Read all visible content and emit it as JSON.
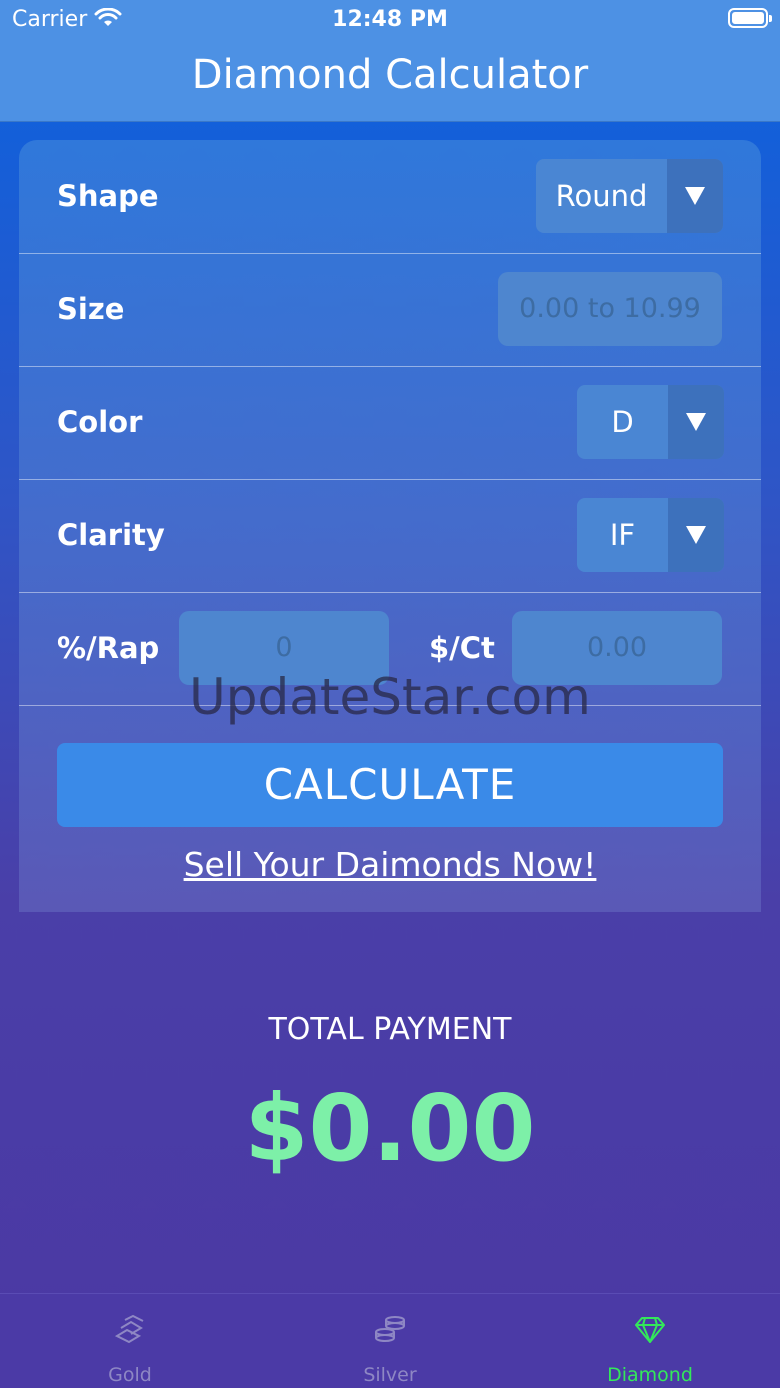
{
  "status_bar": {
    "carrier": "Carrier",
    "time": "12:48 PM"
  },
  "nav": {
    "title": "Diamond Calculator"
  },
  "form": {
    "shape": {
      "label": "Shape",
      "value": "Round"
    },
    "size": {
      "label": "Size",
      "placeholder": "0.00 to 10.99"
    },
    "color": {
      "label": "Color",
      "value": "D"
    },
    "clarity": {
      "label": "Clarity",
      "value": "IF"
    },
    "rap": {
      "label": "%/Rap",
      "placeholder": "0"
    },
    "per_ct": {
      "label": "$/Ct",
      "placeholder": "0.00"
    }
  },
  "calculate_label": "CALCULATE",
  "sell_link": "Sell Your Daimonds Now!",
  "watermark": "UpdateStar.com",
  "total": {
    "label": "TOTAL PAYMENT",
    "amount": "$0.00"
  },
  "tabs": [
    {
      "label": "Gold",
      "icon": "gold-bars-icon",
      "active": false
    },
    {
      "label": "Silver",
      "icon": "silver-coins-icon",
      "active": false
    },
    {
      "label": "Diamond",
      "icon": "diamond-icon",
      "active": true
    }
  ],
  "colors": {
    "accent": "#3a8ae8",
    "total": "#7df0a8",
    "active_tab": "#33e85a"
  }
}
